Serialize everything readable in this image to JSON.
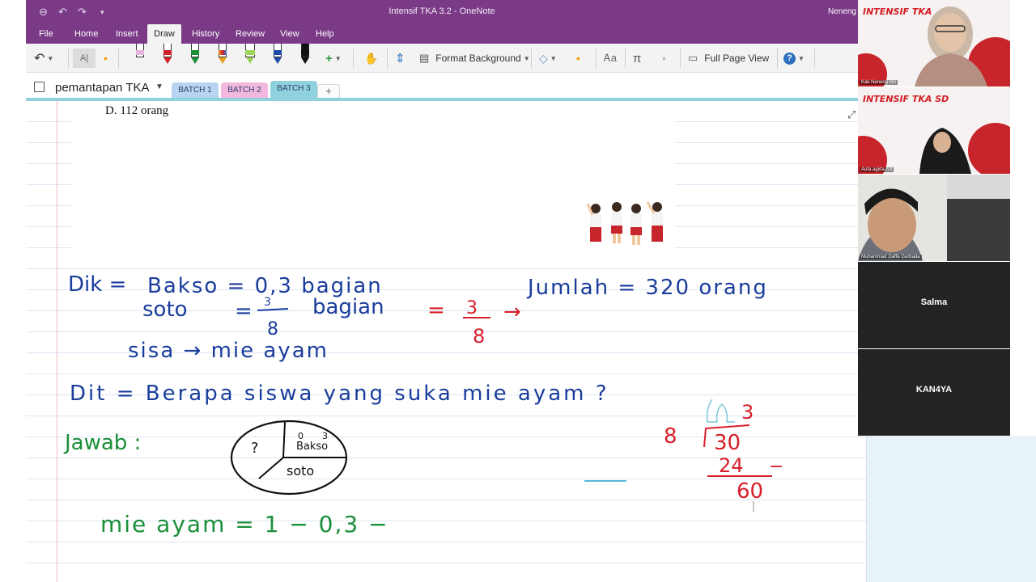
{
  "window": {
    "title": "Intensif TKA 3.2  -  OneNote",
    "user": "Neneng"
  },
  "ribbon_tabs": [
    "File",
    "Home",
    "Insert",
    "Draw",
    "History",
    "Review",
    "View",
    "Help"
  ],
  "active_tab": "Draw",
  "toolbar": {
    "format_background": "Format Background",
    "full_page_view": "Full Page View",
    "pen_colors": [
      "#d71f2a",
      "#1a8f3a",
      "#e8a020",
      "#9fd45a",
      "#1e4aa8",
      "#111111"
    ]
  },
  "notebook": {
    "name": "pemantapan TKA",
    "sections": [
      {
        "label": "BATCH 1",
        "color": "#b8d4f0"
      },
      {
        "label": "BATCH 2",
        "color": "#f2b8de"
      },
      {
        "label": "BATCH 3",
        "color": "#8fd1dc"
      }
    ],
    "add_label": "+"
  },
  "page": {
    "typed_text": "D. 112 orang"
  },
  "ink": {
    "dik_label": "Dik =",
    "bakso_line": "Bakso  = 0,3 bagian",
    "soto_word": "soto",
    "soto_eq": "=",
    "frac_num": "3",
    "frac_den": "8",
    "bagian": "bagian",
    "red_eq": "=",
    "red_num": "3",
    "red_den": "8",
    "red_arrow": "→",
    "jumlah": "Jumlah = 320 orang",
    "sisa": "sisa → mie ayam",
    "dit": "Dit = Berapa siswa yang suka mie ayam ?",
    "jawab": "Jawab :",
    "pie_q": "?",
    "pie_bakso_num": "0",
    "pie_bakso_den": "3",
    "pie_bakso": "Bakso",
    "pie_soto": "soto",
    "mie_line": "mie ayam = 1 − 0,3 −",
    "div_divisor": "8",
    "div_dividend": "30",
    "div_quotient": "3",
    "div_sub": "24",
    "div_minus": "−",
    "div_rem": "60"
  },
  "participants": [
    {
      "name": "Kak Neneng NS",
      "banner": "INTENSIF TKA"
    },
    {
      "name": "Aufa agida n.ll",
      "banner": "INTENSIF TKA SD"
    },
    {
      "name": "Muhammad Daffa Gurbada",
      "banner": ""
    },
    {
      "name": "Salma",
      "banner": ""
    },
    {
      "name": "KAN4YA",
      "banner": ""
    }
  ]
}
